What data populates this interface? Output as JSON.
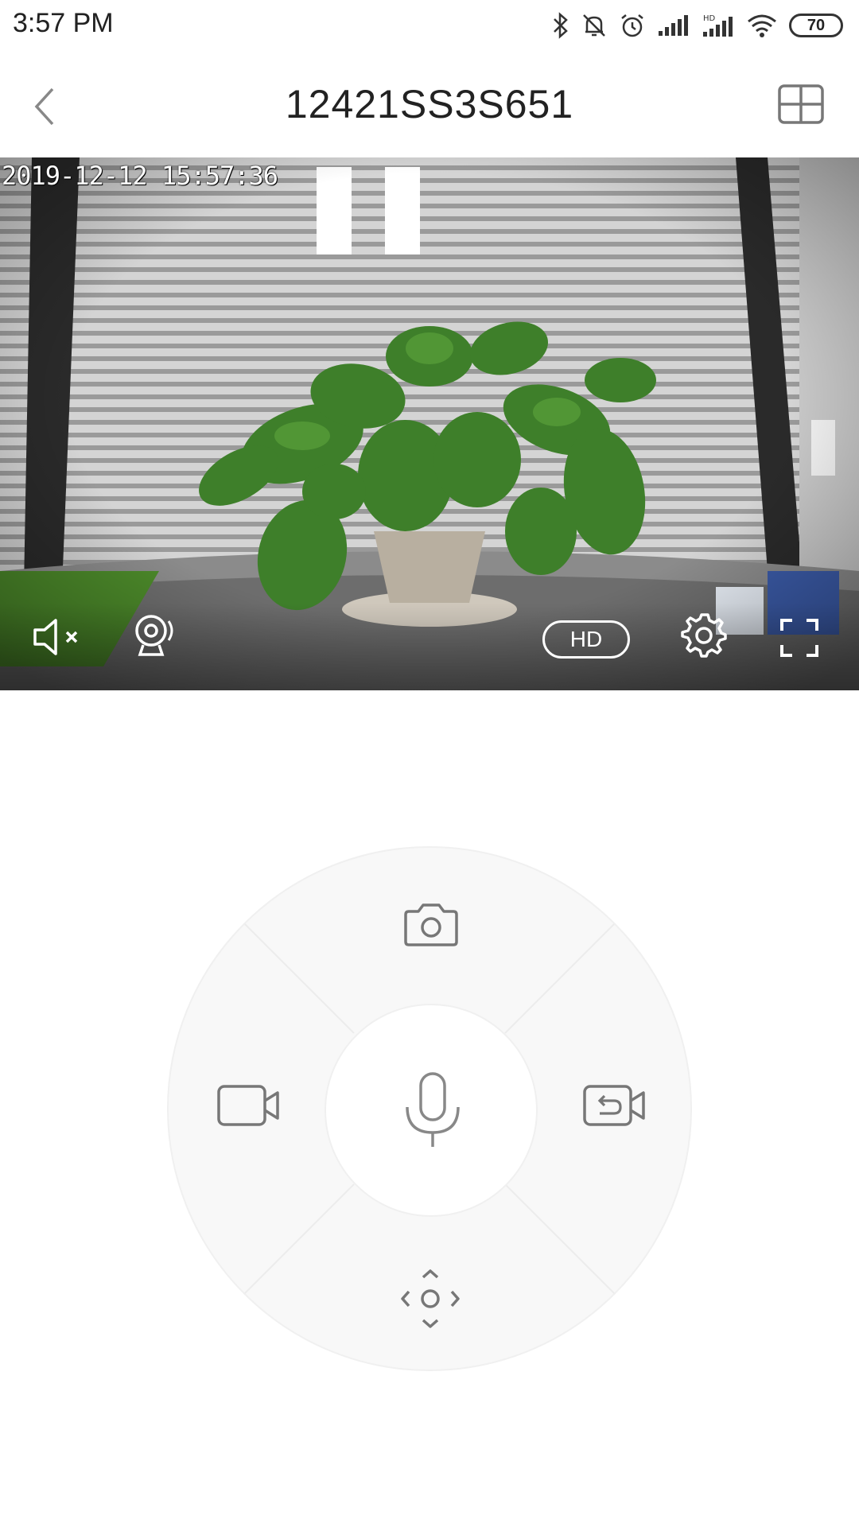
{
  "status_bar": {
    "time": "3:57 PM",
    "battery": "70",
    "icons": [
      "bluetooth-icon",
      "mute-bell-icon",
      "alarm-icon",
      "signal-icon",
      "signal-hd-icon",
      "wifi-icon",
      "battery-icon"
    ]
  },
  "header": {
    "title": "12421SS3S651",
    "back_icon": "chevron-left-icon",
    "layout_icon": "grid-layout-icon"
  },
  "video": {
    "timestamp": "2019-12-12 15:57:36",
    "controls": {
      "mute_icon": "speaker-muted-icon",
      "camera_icon": "webcam-icon",
      "quality_label": "HD",
      "settings_icon": "gear-icon",
      "fullscreen_icon": "fullscreen-icon"
    }
  },
  "control_wheel": {
    "top": "camera-icon",
    "left": "video-record-icon",
    "right": "playback-icon",
    "bottom": "pan-direction-icon",
    "center": "microphone-icon"
  }
}
